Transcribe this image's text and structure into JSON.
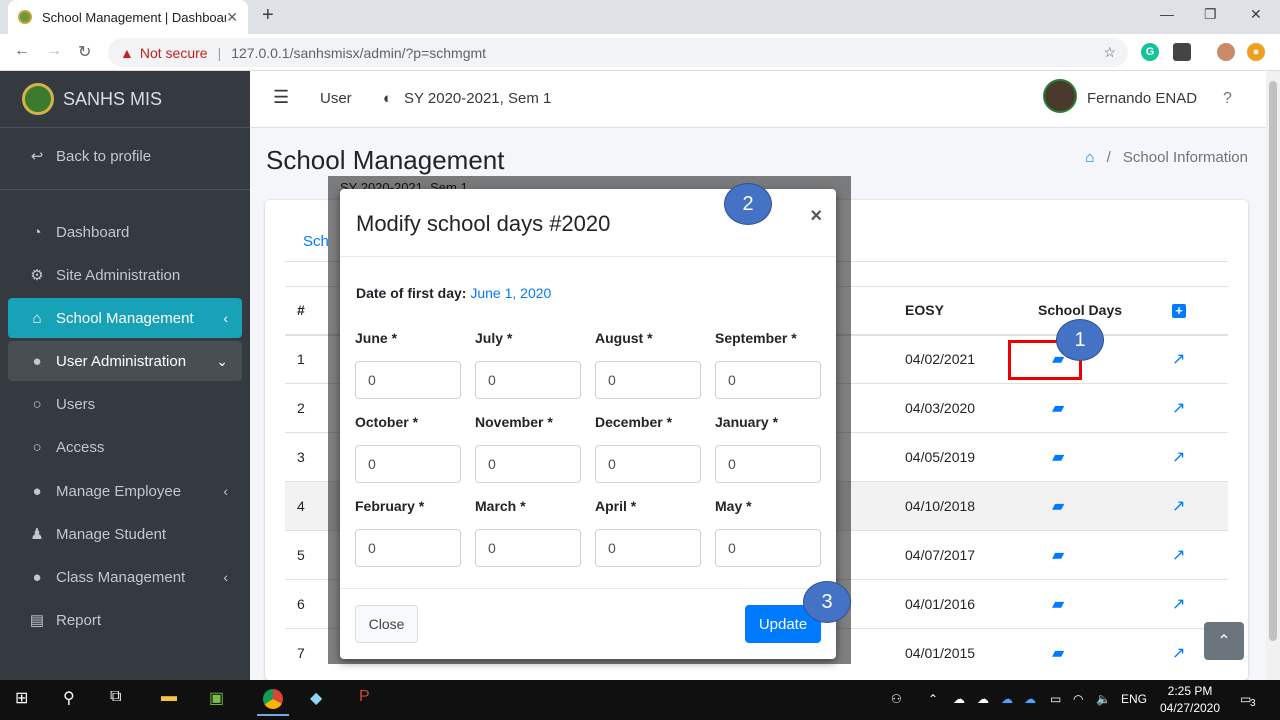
{
  "browser": {
    "tab_title": "School Management | Dashboard",
    "tab_close": "✕",
    "new_tab": "+",
    "not_secure": "Not secure",
    "url": "127.0.0.1/sanhsmisx/admin/?p=schmgmt"
  },
  "sidebar": {
    "brand": "SANHS MIS",
    "items": [
      {
        "label": "Back to profile",
        "icon": "back-arrow-icon"
      },
      {
        "label": "Dashboard",
        "icon": "tachometer-icon"
      },
      {
        "label": "Site Administration",
        "icon": "cogs-icon"
      },
      {
        "label": "School Management",
        "icon": "school-icon"
      },
      {
        "label": "User Administration",
        "icon": "user-icon"
      },
      {
        "label": "Users",
        "icon": "circle-icon"
      },
      {
        "label": "Access",
        "icon": "circle-icon"
      },
      {
        "label": "Manage Employee",
        "icon": "user-icon"
      },
      {
        "label": "Manage Student",
        "icon": "student-icon"
      },
      {
        "label": "Class Management",
        "icon": "user-icon"
      },
      {
        "label": "Report",
        "icon": "file-icon"
      }
    ]
  },
  "topnav": {
    "menu_item": "User",
    "school_year": "SY 2020-2021, Sem 1",
    "user_name": "Fernando ENAD"
  },
  "page": {
    "title": "School Management",
    "breadcrumb": "School Information",
    "tab_partial": "Sch"
  },
  "table": {
    "headers": {
      "num": "#",
      "eosy": "EOSY",
      "school_days": "School Days"
    },
    "rows": [
      {
        "num": "1",
        "eosy": "04/02/2021"
      },
      {
        "num": "2",
        "eosy": "04/03/2020"
      },
      {
        "num": "3",
        "eosy": "04/05/2019"
      },
      {
        "num": "4",
        "eosy": "04/10/2018"
      },
      {
        "num": "5",
        "eosy": "04/07/2017"
      },
      {
        "num": "6",
        "eosy": "04/01/2016"
      },
      {
        "num": "7",
        "eosy": "04/01/2015"
      }
    ]
  },
  "modal": {
    "bleed_text": "SY 2020-2021, Sem 1",
    "title": "Modify school days #2020",
    "close_x": "×",
    "date_label": "Date of first day:",
    "date_value": "June 1, 2020",
    "months": [
      {
        "label": "June *",
        "value": "0"
      },
      {
        "label": "July *",
        "value": "0"
      },
      {
        "label": "August *",
        "value": "0"
      },
      {
        "label": "September *",
        "value": "0"
      },
      {
        "label": "October *",
        "value": "0"
      },
      {
        "label": "November *",
        "value": "0"
      },
      {
        "label": "December *",
        "value": "0"
      },
      {
        "label": "January *",
        "value": "0"
      },
      {
        "label": "February *",
        "value": "0"
      },
      {
        "label": "March *",
        "value": "0"
      },
      {
        "label": "April *",
        "value": "0"
      },
      {
        "label": "May *",
        "value": "0"
      }
    ],
    "close_button": "Close",
    "update_button": "Update"
  },
  "callouts": [
    "1",
    "2",
    "3"
  ],
  "taskbar": {
    "lang": "ENG",
    "time": "2:25 PM",
    "date": "04/27/2020",
    "notifications": "3"
  },
  "colors": {
    "sidebar_bg": "#343a40",
    "active_nav": "#17a2b8",
    "primary": "#007bff",
    "callout": "#4472c4",
    "highlight_box": "#ee0000"
  }
}
